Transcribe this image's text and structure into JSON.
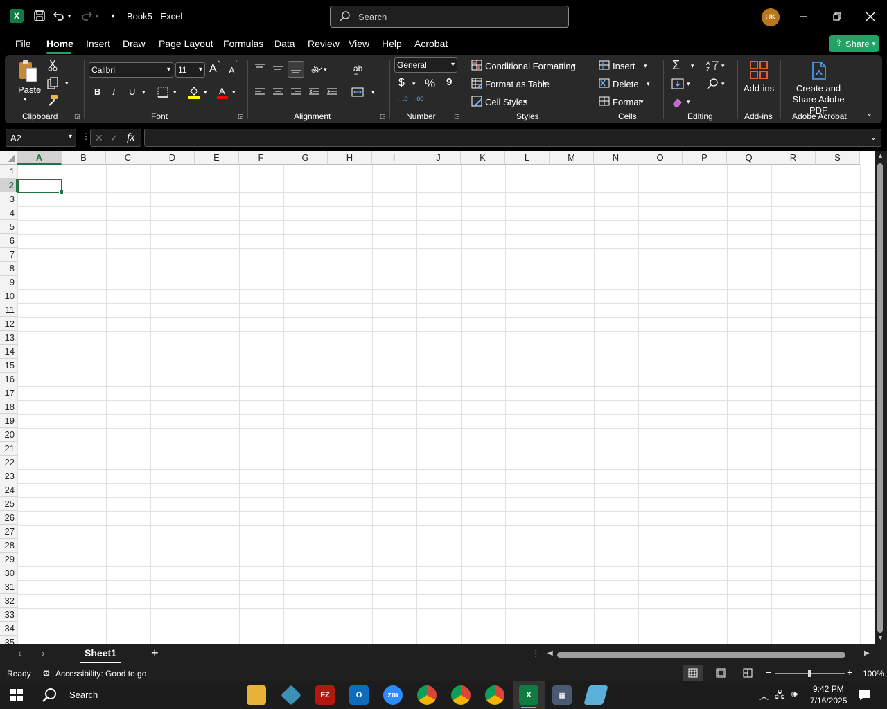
{
  "titlebar": {
    "doc_title": "Book5  -  Excel",
    "search_placeholder": "Search",
    "avatar_initials": "UK",
    "app_badge": "X"
  },
  "menu": {
    "tabs": [
      "File",
      "Home",
      "Insert",
      "Draw",
      "Page Layout",
      "Formulas",
      "Data",
      "Review",
      "View",
      "Help",
      "Acrobat"
    ],
    "active": "Home",
    "share_label": "Share"
  },
  "ribbon": {
    "clipboard": {
      "paste": "Paste",
      "group": "Clipboard"
    },
    "font": {
      "name": "Calibri",
      "size": "11",
      "bold": "B",
      "italic": "I",
      "underline": "U",
      "grow": "A",
      "shrink": "A",
      "color_letter": "A",
      "group": "Font",
      "fill_color": "#ffff00",
      "font_color": "#ff0000"
    },
    "alignment": {
      "wrap": "ab",
      "group": "Alignment"
    },
    "number": {
      "format": "General",
      "currency": "$",
      "percent": "%",
      "comma": "9",
      "inc": "←.0",
      "dec": ".00",
      "group": "Number"
    },
    "styles": {
      "conditional": "Conditional Formatting",
      "format_table": "Format as Table",
      "cell_styles": "Cell Styles",
      "group": "Styles"
    },
    "cells": {
      "insert": "Insert",
      "delete": "Delete",
      "format": "Format",
      "group": "Cells"
    },
    "editing": {
      "group": "Editing"
    },
    "addins": {
      "label": "Add-ins",
      "group": "Add-ins"
    },
    "acrobat": {
      "label": "Create and Share Adobe PDF",
      "group": "Adobe Acrobat"
    }
  },
  "formula_bar": {
    "name_box": "A2",
    "fx": "fx",
    "value": ""
  },
  "grid": {
    "columns": [
      "A",
      "B",
      "C",
      "D",
      "E",
      "F",
      "G",
      "H",
      "I",
      "J",
      "K",
      "L",
      "M",
      "N",
      "O",
      "P",
      "Q",
      "R",
      "S"
    ],
    "rows": [
      "1",
      "2",
      "3",
      "4",
      "5",
      "6",
      "7",
      "8",
      "9",
      "10",
      "11",
      "12",
      "13",
      "14",
      "15",
      "16",
      "17",
      "18",
      "19",
      "20",
      "21",
      "22",
      "23",
      "24",
      "25",
      "26",
      "27",
      "28",
      "29",
      "30",
      "31",
      "32",
      "33",
      "34",
      "35"
    ],
    "active_col": "A",
    "active_row": "2"
  },
  "sheets": {
    "tabs": [
      "Sheet1"
    ],
    "active": "Sheet1"
  },
  "status": {
    "ready": "Ready",
    "accessibility": "Accessibility: Good to go",
    "zoom": "100%"
  },
  "taskbar": {
    "search": "Search",
    "time": "9:42 PM",
    "date": "7/16/2025"
  }
}
